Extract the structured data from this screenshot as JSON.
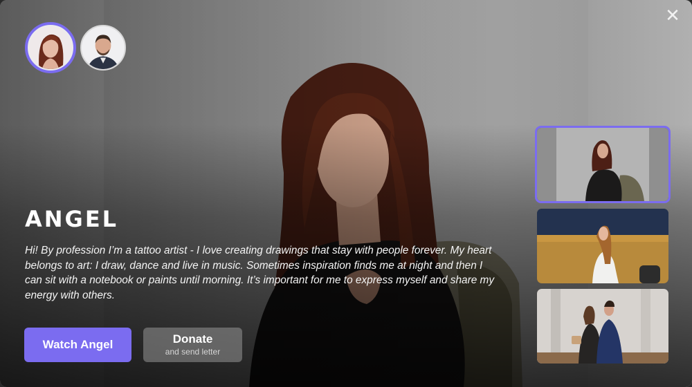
{
  "profile": {
    "name": "ANGEL",
    "bio": "Hi! By profession I’m a tattoo artist - I love creating drawings that stay with people forever. My heart belongs to art: I draw, dance and live in music. Sometimes inspiration finds me at night and then I can sit with a notebook or paints until morning. It’s important for me to express myself and share my energy with others."
  },
  "buttons": {
    "watch_label": "Watch Angel",
    "donate_label": "Donate",
    "donate_sublabel": "and send letter"
  },
  "close": {
    "icon": "close-icon",
    "glyph": "✕"
  },
  "colors": {
    "accent": "#7b6cf0"
  }
}
